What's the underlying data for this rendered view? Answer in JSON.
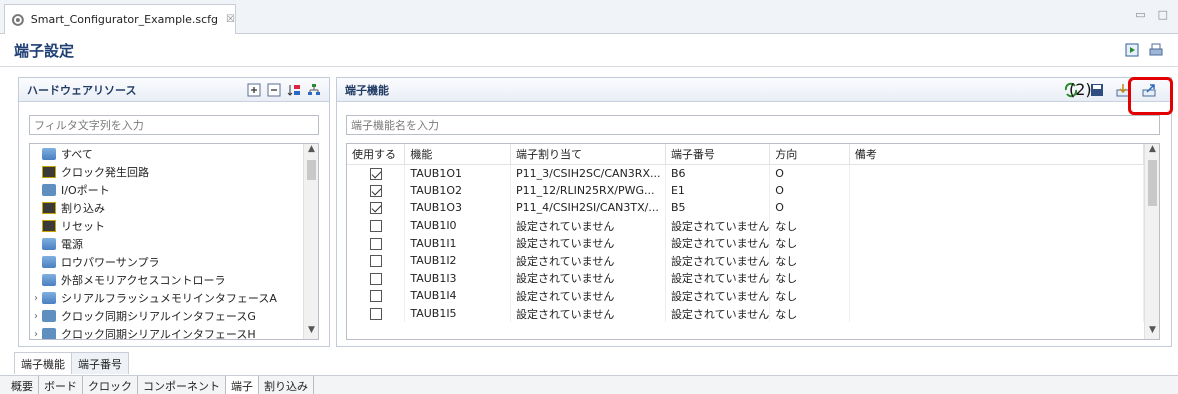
{
  "editor": {
    "tab_title": "Smart_Configurator_Example.scfg",
    "tab_close": "☒"
  },
  "page": {
    "title": "端子設定"
  },
  "hardware_panel": {
    "title": "ハードウェアリソース",
    "filter_placeholder": "フィルタ文字列を入力",
    "tree": [
      {
        "label": "すべて",
        "icon": "network-icon",
        "expandable": false
      },
      {
        "label": "クロック発生回路",
        "icon": "chip-icon",
        "expandable": false
      },
      {
        "label": "I/Oポート",
        "icon": "port-icon",
        "expandable": false
      },
      {
        "label": "割り込み",
        "icon": "chip-icon",
        "expandable": false
      },
      {
        "label": "リセット",
        "icon": "chip-icon",
        "expandable": false
      },
      {
        "label": "電源",
        "icon": "network-icon",
        "expandable": false
      },
      {
        "label": "ロウパワーサンプラ",
        "icon": "network-icon",
        "expandable": false
      },
      {
        "label": "外部メモリアクセスコントローラ",
        "icon": "network-icon",
        "expandable": false
      },
      {
        "label": "シリアルフラッシュメモリインタフェースA",
        "icon": "network-icon",
        "expandable": true
      },
      {
        "label": "クロック同期シリアルインタフェースG",
        "icon": "port-icon",
        "expandable": true
      },
      {
        "label": "クロック同期シリアルインタフェースH",
        "icon": "port-icon",
        "expandable": true
      }
    ]
  },
  "function_panel": {
    "title": "端子機能",
    "filter_placeholder": "端子機能名を入力",
    "columns": [
      "使用する",
      "機能",
      "端子割り当て",
      "端子番号",
      "方向",
      "備考"
    ],
    "rows": [
      {
        "use": true,
        "function": "TAUB1O1",
        "assign": "P11_3/CSIH2SC/CAN3RX...",
        "pin": "B6",
        "dir": "O",
        "note": ""
      },
      {
        "use": true,
        "function": "TAUB1O2",
        "assign": "P11_12/RLIN25RX/PWG...",
        "pin": "E1",
        "dir": "O",
        "note": ""
      },
      {
        "use": true,
        "function": "TAUB1O3",
        "assign": "P11_4/CSIH2SI/CAN3TX/...",
        "pin": "B5",
        "dir": "O",
        "note": ""
      },
      {
        "use": false,
        "function": "TAUB1I0",
        "assign": "設定されていません",
        "pin": "設定されていません",
        "dir": "なし",
        "note": ""
      },
      {
        "use": false,
        "function": "TAUB1I1",
        "assign": "設定されていません",
        "pin": "設定されていません",
        "dir": "なし",
        "note": ""
      },
      {
        "use": false,
        "function": "TAUB1I2",
        "assign": "設定されていません",
        "pin": "設定されていません",
        "dir": "なし",
        "note": ""
      },
      {
        "use": false,
        "function": "TAUB1I3",
        "assign": "設定されていません",
        "pin": "設定されていません",
        "dir": "なし",
        "note": ""
      },
      {
        "use": false,
        "function": "TAUB1I4",
        "assign": "設定されていません",
        "pin": "設定されていません",
        "dir": "なし",
        "note": ""
      },
      {
        "use": false,
        "function": "TAUB1I5",
        "assign": "設定されていません",
        "pin": "設定されていません",
        "dir": "なし",
        "note": ""
      }
    ]
  },
  "annotation": {
    "label": "(2)",
    "color": "#e20000"
  },
  "bottom_tabs": [
    "端子機能",
    "端子番号"
  ],
  "footer_tabs": [
    "概要",
    "ボード",
    "クロック",
    "コンポーネント",
    "端子",
    "割り込み"
  ],
  "colors": {
    "accent": "#1f3f73",
    "panel_header": "#e9eef6",
    "highlight": "#e20000"
  }
}
